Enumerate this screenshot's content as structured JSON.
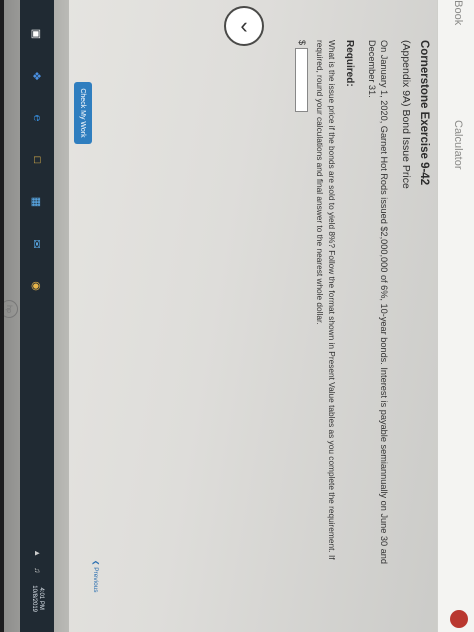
{
  "header": {
    "ebook_label": "eBook",
    "calculator_label": "Calculator"
  },
  "exercise": {
    "title": "Cornerstone Exercise 9-42",
    "subtitle": "(Appendix 9A) Bond Issue Price",
    "body": "On January 1, 2020, Garnet Hot Rods issued $2,000,000 of 6%, 10-year bonds. Interest is payable semiannually on June 30 and December 31.",
    "required_label": "Required:",
    "question": "What is the issue price if the bonds are sold to yield 8%? Follow the format shown in Present Value tables as you complete the requirement. If required, round your calculations and final answer to the nearest whole dollar.",
    "currency_symbol": "$",
    "answer_value": ""
  },
  "footer": {
    "check_button_label": "Check My Work",
    "previous_label": "Previous"
  },
  "taskbar": {
    "icons": [
      "task-view-icon",
      "dropbox-icon",
      "edge-icon",
      "file-explorer-icon",
      "store-icon",
      "mail-icon",
      "chrome-icon"
    ],
    "time": "4:01 PM",
    "date": "10/8/2019"
  },
  "colors": {
    "button_blue": "#2f7ebf",
    "taskbar": "#202a33"
  }
}
